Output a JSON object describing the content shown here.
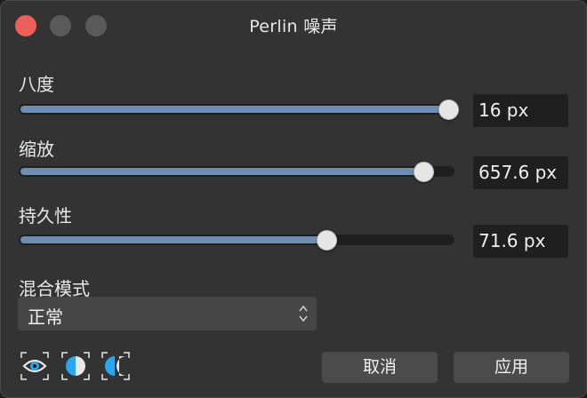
{
  "window": {
    "title": "Perlin 噪声"
  },
  "params": [
    {
      "label": "八度",
      "value": "16 px",
      "level_pct": 100
    },
    {
      "label": "缩放",
      "value": "657.6 px",
      "level_pct": 94
    },
    {
      "label": "持久性",
      "value": "71.6 px",
      "level_pct": 71
    }
  ],
  "blend": {
    "label": "混合模式",
    "selected": "正常"
  },
  "buttons": {
    "cancel": "取消",
    "apply": "应用"
  },
  "icons": [
    "eye-icon",
    "split-view-icon",
    "mirror-split-icon"
  ],
  "colors": {
    "accent": "#6e8db3",
    "close": "#ec5f5a",
    "icon_blue": "#2aa7f0"
  }
}
